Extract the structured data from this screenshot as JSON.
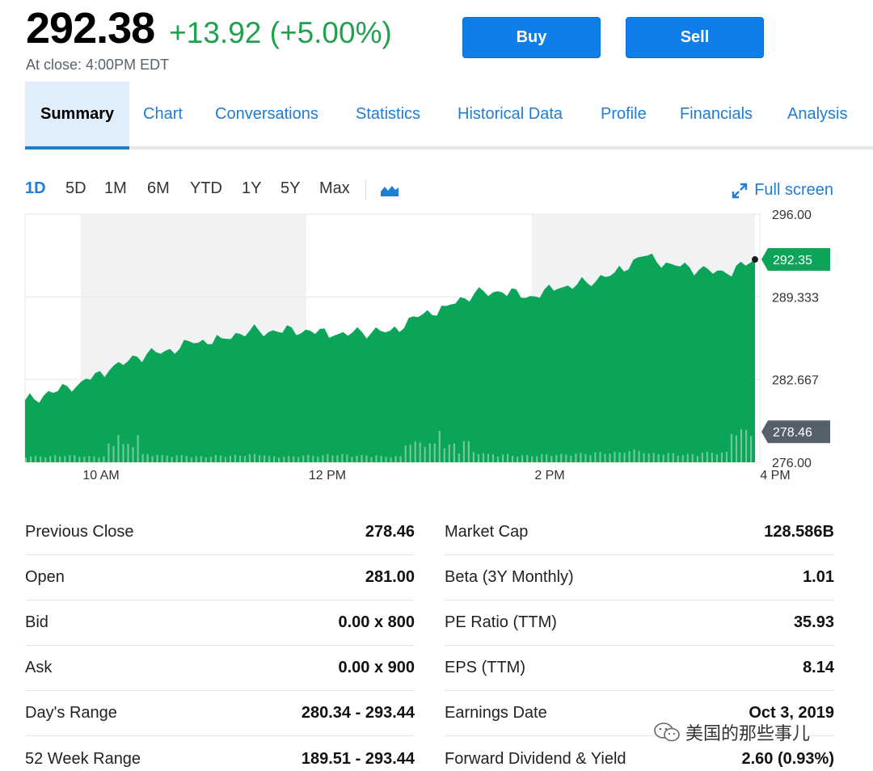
{
  "quote": {
    "price": "292.38",
    "change": "+13.92 (+5.00%)",
    "close_time": "At close: 4:00PM EDT"
  },
  "actions": {
    "buy_label": "Buy",
    "sell_label": "Sell"
  },
  "tabs": [
    "Summary",
    "Chart",
    "Conversations",
    "Statistics",
    "Historical Data",
    "Profile",
    "Financials",
    "Analysis"
  ],
  "active_tab": "Summary",
  "ranges": [
    "1D",
    "5D",
    "1M",
    "6M",
    "YTD",
    "1Y",
    "5Y",
    "Max"
  ],
  "active_range": "1D",
  "chart_type_icon": "area-chart-icon",
  "fullscreen_label": "Full screen",
  "fullscreen_icon": "expand-arrows-icon",
  "colors": {
    "accent": "#1f7dd4",
    "positive": "#21a150",
    "area_fill": "#0aa558",
    "button": "#0f7ee8",
    "prev_close_tag": "#55606a"
  },
  "chart_data": {
    "type": "area",
    "x_ticks": [
      "10 AM",
      "12 PM",
      "2 PM",
      "4 PM"
    ],
    "y_ticks": [
      "296.00",
      "289.333",
      "282.667",
      "276.00"
    ],
    "ylim": [
      276.0,
      296.0
    ],
    "last_price_label": "292.35",
    "last_price": 292.35,
    "prev_close_label": "278.46",
    "prev_close": 278.46,
    "times": [
      "9:30",
      "9:45",
      "10:00",
      "10:15",
      "10:30",
      "10:45",
      "11:00",
      "11:15",
      "11:30",
      "11:45",
      "12:00",
      "12:15",
      "12:30",
      "12:45",
      "13:00",
      "13:15",
      "13:30",
      "13:45",
      "14:00",
      "14:15",
      "14:30",
      "14:45",
      "15:00",
      "15:15",
      "15:30",
      "15:45",
      "16:00"
    ],
    "prices": [
      281.0,
      281.6,
      282.5,
      283.4,
      284.5,
      285.0,
      285.6,
      286.0,
      286.6,
      286.5,
      286.7,
      286.2,
      286.5,
      286.6,
      287.7,
      288.6,
      289.6,
      289.7,
      289.4,
      290.0,
      290.5,
      291.3,
      292.6,
      292.0,
      291.5,
      291.2,
      292.35
    ],
    "volume_relative": [
      0.3,
      0.35,
      0.3,
      0.9,
      0.4,
      0.35,
      0.3,
      0.35,
      0.4,
      0.3,
      0.35,
      0.4,
      0.35,
      0.3,
      1.0,
      0.9,
      0.5,
      0.4,
      0.35,
      0.4,
      0.45,
      0.5,
      0.6,
      0.45,
      0.4,
      0.5,
      1.6
    ]
  },
  "stats_left": [
    {
      "label": "Previous Close",
      "value": "278.46"
    },
    {
      "label": "Open",
      "value": "281.00"
    },
    {
      "label": "Bid",
      "value": "0.00 x 800"
    },
    {
      "label": "Ask",
      "value": "0.00 x 900"
    },
    {
      "label": "Day's Range",
      "value": "280.34 - 293.44"
    },
    {
      "label": "52 Week Range",
      "value": "189.51 - 293.44"
    }
  ],
  "stats_right": [
    {
      "label": "Market Cap",
      "value": "128.586B"
    },
    {
      "label": "Beta (3Y Monthly)",
      "value": "1.01"
    },
    {
      "label": "PE Ratio (TTM)",
      "value": "35.93"
    },
    {
      "label": "EPS (TTM)",
      "value": "8.14"
    },
    {
      "label": "Earnings Date",
      "value": "Oct 3, 2019"
    },
    {
      "label": "Forward Dividend & Yield",
      "value": "2.60 (0.93%)"
    }
  ],
  "watermark": {
    "text": "美国的那些事儿",
    "icon": "wechat-icon"
  }
}
